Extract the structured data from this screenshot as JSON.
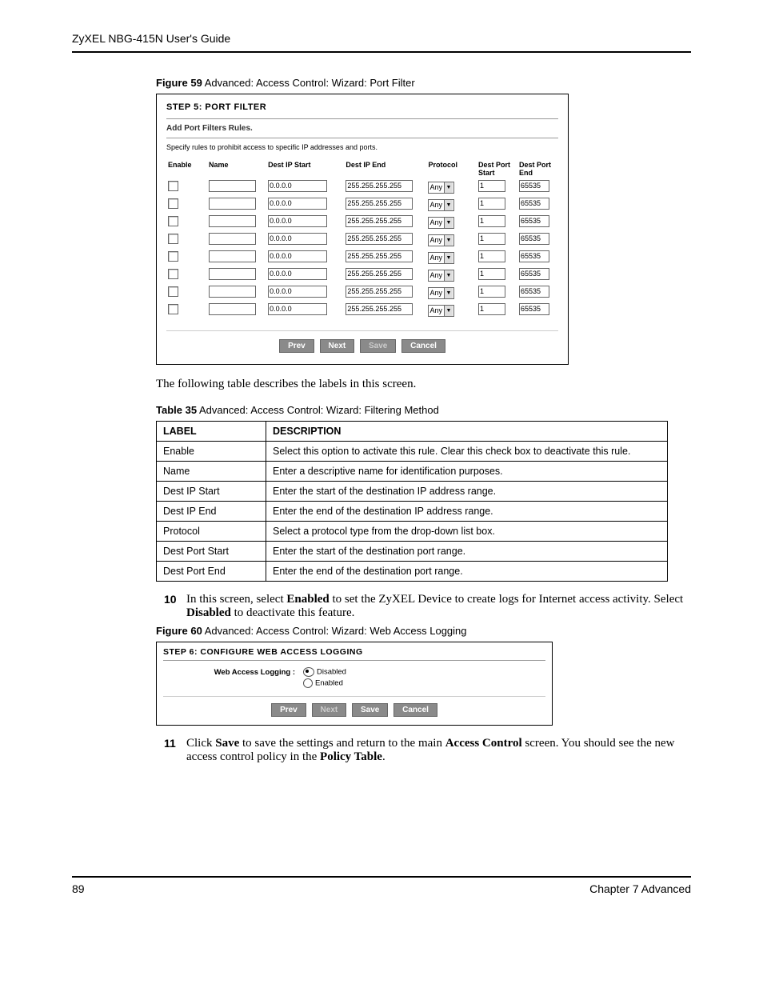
{
  "header": "ZyXEL NBG-415N User's Guide",
  "fig59": {
    "caption_bold": "Figure 59",
    "caption": "   Advanced: Access Control: Wizard: Port Filter",
    "step_title": "STEP 5: PORT FILTER",
    "subtitle": "Add Port Filters Rules.",
    "desc": "Specify rules to prohibit access to specific IP addresses and ports.",
    "cols": {
      "enable": "Enable",
      "name": "Name",
      "ip_start": "Dest IP Start",
      "ip_end": "Dest IP End",
      "protocol": "Protocol",
      "port_start": "Dest Port Start",
      "port_end": "Dest Port End"
    },
    "rows": [
      {
        "ip_start": "0.0.0.0",
        "ip_end": "255.255.255.255",
        "protocol": "Any",
        "ps": "1",
        "pe": "65535"
      },
      {
        "ip_start": "0.0.0.0",
        "ip_end": "255.255.255.255",
        "protocol": "Any",
        "ps": "1",
        "pe": "65535"
      },
      {
        "ip_start": "0.0.0.0",
        "ip_end": "255.255.255.255",
        "protocol": "Any",
        "ps": "1",
        "pe": "65535"
      },
      {
        "ip_start": "0.0.0.0",
        "ip_end": "255.255.255.255",
        "protocol": "Any",
        "ps": "1",
        "pe": "65535"
      },
      {
        "ip_start": "0.0.0.0",
        "ip_end": "255.255.255.255",
        "protocol": "Any",
        "ps": "1",
        "pe": "65535"
      },
      {
        "ip_start": "0.0.0.0",
        "ip_end": "255.255.255.255",
        "protocol": "Any",
        "ps": "1",
        "pe": "65535"
      },
      {
        "ip_start": "0.0.0.0",
        "ip_end": "255.255.255.255",
        "protocol": "Any",
        "ps": "1",
        "pe": "65535"
      },
      {
        "ip_start": "0.0.0.0",
        "ip_end": "255.255.255.255",
        "protocol": "Any",
        "ps": "1",
        "pe": "65535"
      }
    ],
    "buttons": {
      "prev": "Prev",
      "next": "Next",
      "save": "Save",
      "cancel": "Cancel"
    }
  },
  "para1": "The following table describes the labels in this screen.",
  "table35": {
    "caption_bold": "Table 35",
    "caption": "   Advanced: Access Control: Wizard: Filtering Method",
    "head": {
      "label": "LABEL",
      "desc": "DESCRIPTION"
    },
    "rows": [
      {
        "label": "Enable",
        "desc": "Select this option to activate this rule. Clear this check box to deactivate this rule."
      },
      {
        "label": "Name",
        "desc": "Enter a descriptive name for identification purposes."
      },
      {
        "label": "Dest IP Start",
        "desc": "Enter the start of the destination IP address range."
      },
      {
        "label": "Dest IP End",
        "desc": "Enter the end of the destination IP address range."
      },
      {
        "label": "Protocol",
        "desc": "Select a protocol type from the drop-down list box."
      },
      {
        "label": "Dest Port Start",
        "desc": "Enter the start of the destination port range."
      },
      {
        "label": "Dest Port End",
        "desc": "Enter the end of the destination port range."
      }
    ]
  },
  "step10": {
    "num": "10",
    "pre": "In this screen, select ",
    "b1": "Enabled",
    "mid": " to set the ZyXEL Device to create logs for Internet access activity. Select ",
    "b2": "Disabled",
    "post": " to deactivate this feature."
  },
  "fig60": {
    "caption_bold": "Figure 60",
    "caption": "   Advanced: Access Control: Wizard: Web Access Logging",
    "step_title": "STEP 6: CONFIGURE WEB ACCESS LOGGING",
    "label": "Web Access Logging :",
    "opt1": "Disabled",
    "opt2": "Enabled",
    "buttons": {
      "prev": "Prev",
      "next": "Next",
      "save": "Save",
      "cancel": "Cancel"
    }
  },
  "step11": {
    "num": "11",
    "pre": "Click ",
    "b1": "Save",
    "mid": " to save the settings and return to the main ",
    "b2": "Access Control",
    "mid2": " screen. You should see the new access control policy in the ",
    "b3": "Policy Table",
    "post": "."
  },
  "footer": {
    "page": "89",
    "chapter": "Chapter 7 Advanced"
  }
}
